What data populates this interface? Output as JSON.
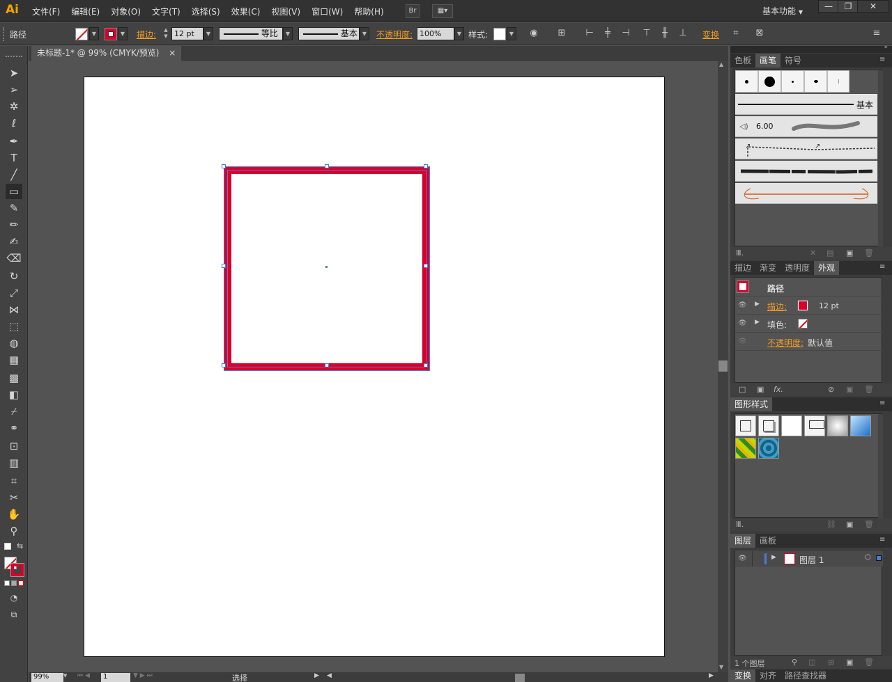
{
  "menubar": {
    "logo": "Ai",
    "menus": [
      "文件(F)",
      "编辑(E)",
      "对象(O)",
      "文字(T)",
      "选择(S)",
      "效果(C)",
      "视图(V)",
      "窗口(W)",
      "帮助(H)"
    ],
    "bridge": "Br",
    "workspace": "基本功能",
    "win_min": "—",
    "win_max": "❐",
    "win_close": "✕"
  },
  "controlbar": {
    "selection": "路径",
    "stroke_label": "描边:",
    "stroke_weight": "12 pt",
    "profile": "等比",
    "brush": "基本",
    "opacity_label": "不透明度:",
    "opacity": "100%",
    "style_label": "样式:",
    "transform": "变换"
  },
  "document": {
    "tab_title": "未标题-1* @ 99% (CMYK/预览)",
    "close": "×"
  },
  "status": {
    "zoom": "99%",
    "page": "1",
    "mode": "选择"
  },
  "brushes_panel": {
    "tabs": [
      "色板",
      "画笔",
      "符号"
    ],
    "basic_label": "基本",
    "brush_size": "6.00"
  },
  "appearance_panel": {
    "tabs": [
      "描边",
      "渐变",
      "透明度",
      "外观"
    ],
    "object": "路径",
    "stroke_label": "描边:",
    "stroke_weight": "12 pt",
    "fill_label": "填色:",
    "opacity_label": "不透明度:",
    "opacity_value": "默认值",
    "fx": "fx."
  },
  "graphic_styles_panel": {
    "tabs": [
      "图形样式"
    ]
  },
  "layers_panel": {
    "tabs": [
      "图层",
      "画板"
    ],
    "layer_name": "图层 1",
    "footer_count": "1 个图层"
  },
  "bottom_tabs": [
    "变换",
    "对齐",
    "路径查找器"
  ],
  "colors": {
    "stroke": "#d8002a",
    "accent": "#f29c20",
    "selection": "#4a7bd4"
  }
}
